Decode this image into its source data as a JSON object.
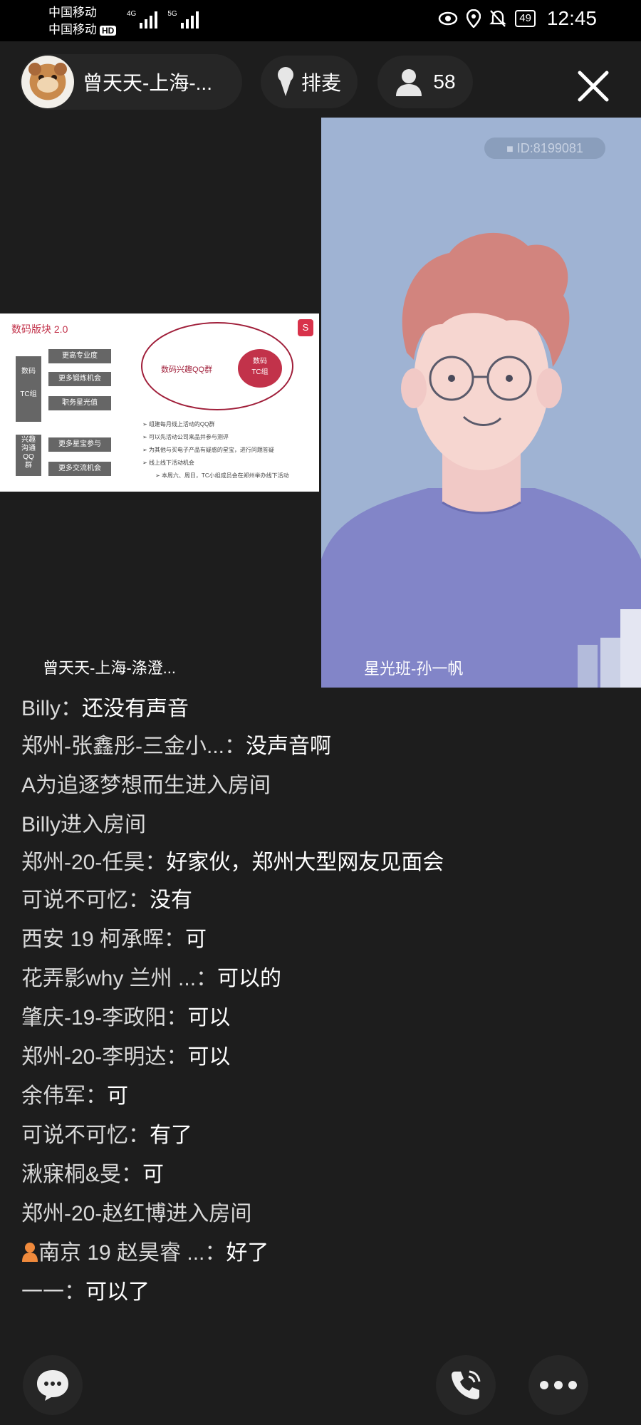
{
  "status_bar": {
    "carrier_1": "中国移动",
    "carrier_2": "中国移动",
    "hd": "HD",
    "signal_1": "4G",
    "signal_2": "5G",
    "battery": "49",
    "time": "12:45"
  },
  "header": {
    "host_name": "曾天天-上海-...",
    "queue_label": "排麦",
    "viewer_count": "58"
  },
  "left_video": {
    "label": "曾天天-上海-涤澄...",
    "slide": {
      "title": "数码版块 2.0",
      "group_label_1": "数码\n\nTC组",
      "group_label_2": "兴趣\n沟通\nQQ\n群",
      "boxes": [
        "更高专业度",
        "更多锻炼机会",
        "职务星光值",
        "更多星宝参与",
        "更多交流机会"
      ],
      "ellipse_label": "数码兴趣QQ群",
      "circle_label": "数码\nTC组",
      "bullets": [
        "组建每月线上活动的QQ群",
        "可以先活动公司来品并参与测评",
        "为其他与买电子产品有疑惑的星宝，进行问题答疑",
        "线上线下活动机会",
        "本周六、周日，TC小组成员会在郑州举办线下活动"
      ]
    }
  },
  "right_video": {
    "id_badge": "ID:8199081",
    "label": "星光班-孙一帆"
  },
  "chat": {
    "messages": [
      {
        "sender": "Billy",
        "sep": "：",
        "text": "还没有声音"
      },
      {
        "sender": "郑州-张鑫彤-三金小...",
        "sep": "：",
        "text": "没声音啊"
      },
      {
        "sender": "A为追逐梦想而生进入房间",
        "sep": "",
        "text": ""
      },
      {
        "sender": "Billy进入房间",
        "sep": "",
        "text": ""
      },
      {
        "sender": "郑州-20-任昊",
        "sep": "：",
        "text": "好家伙，郑州大型网友见面会"
      },
      {
        "sender": "可说不可忆",
        "sep": "：",
        "text": "没有"
      },
      {
        "sender": "西安 19 柯承晖",
        "sep": "：",
        "text": "可"
      },
      {
        "sender": "花弄影why 兰州 ...",
        "sep": "：",
        "text": "可以的"
      },
      {
        "sender": "肇庆-19-李政阳",
        "sep": "：",
        "text": "可以"
      },
      {
        "sender": "郑州-20-李明达",
        "sep": "：",
        "text": "可以"
      },
      {
        "sender": "余伟军",
        "sep": "：",
        "text": "可"
      },
      {
        "sender": "可说不可忆",
        "sep": "：",
        "text": "有了"
      },
      {
        "sender": "湫寐桐&旻",
        "sep": "：",
        "text": "可"
      },
      {
        "sender": "郑州-20-赵红博进入房间",
        "sep": "",
        "text": ""
      },
      {
        "sender": "南京 19 赵昊睿 ...",
        "sep": "：",
        "text": "好了"
      },
      {
        "sender": "一一",
        "sep": "：",
        "text": "可以了"
      }
    ]
  },
  "icons": {
    "chat": "chat-bubble-icon",
    "call": "phone-icon",
    "more": "more-dots-icon",
    "close": "close-icon",
    "mic": "mic-icon",
    "person": "person-icon"
  }
}
